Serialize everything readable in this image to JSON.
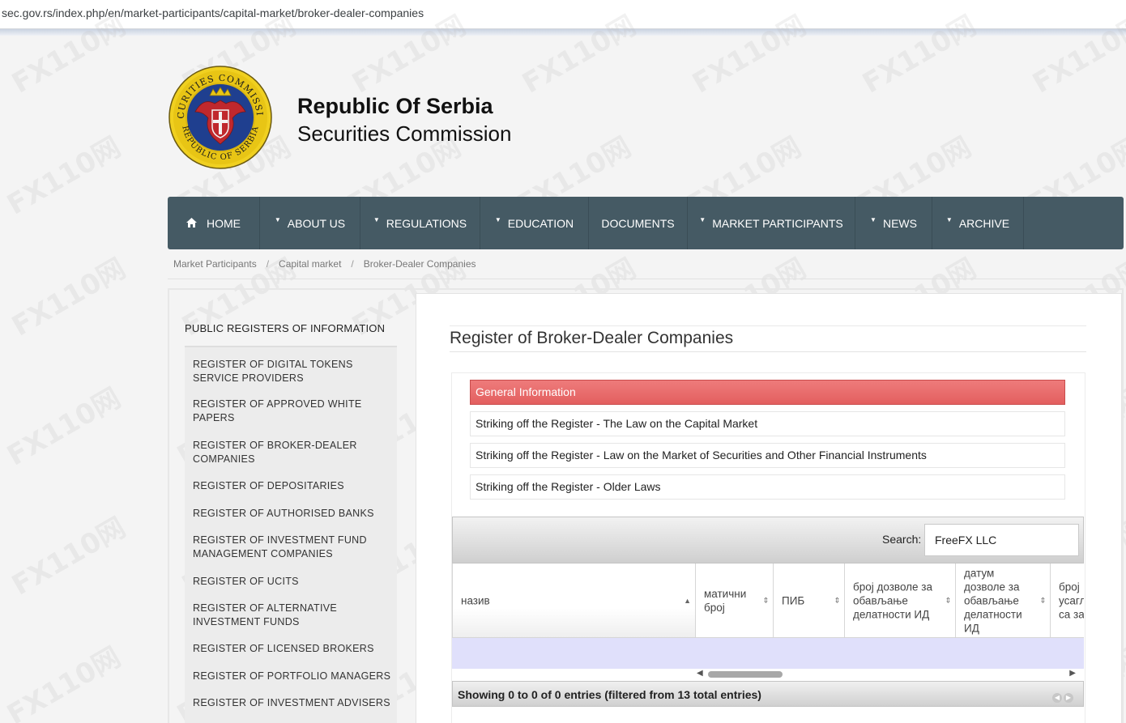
{
  "browser": {
    "url": "sec.gov.rs/index.php/en/market-participants/capital-market/broker-dealer-companies"
  },
  "header": {
    "title": "Republic Of Serbia",
    "subtitle": "Securities Commission",
    "seal_text_top": "SECURITIES COMMISSION",
    "seal_text_bottom": "REPUBLIC OF SERBIA"
  },
  "nav": {
    "items": [
      {
        "label": "HOME",
        "icon": "home-icon",
        "has_dropdown": false
      },
      {
        "label": "ABOUT US",
        "has_dropdown": true
      },
      {
        "label": "REGULATIONS",
        "has_dropdown": true
      },
      {
        "label": "EDUCATION",
        "has_dropdown": true
      },
      {
        "label": "DOCUMENTS",
        "has_dropdown": false
      },
      {
        "label": "MARKET PARTICIPANTS",
        "has_dropdown": true
      },
      {
        "label": "NEWS",
        "has_dropdown": true
      },
      {
        "label": "ARCHIVE",
        "has_dropdown": true
      }
    ],
    "background": "#455a64"
  },
  "breadcrumb": [
    "Market Participants",
    "Capital market",
    "Broker-Dealer Companies"
  ],
  "sidebar": {
    "title": "PUBLIC REGISTERS OF INFORMATION",
    "items": [
      {
        "label": "REGISTER OF DIGITAL TOKENS SERVICE PROVIDERS"
      },
      {
        "label": "REGISTER OF APPROVED WHITE PAPERS"
      },
      {
        "label": "REGISTER OF BROKER-DEALER COMPANIES"
      },
      {
        "label": "REGISTER OF DEPOSITARIES"
      },
      {
        "label": "REGISTER OF AUTHORISED BANKS"
      },
      {
        "label": "REGISTER OF INVESTMENT FUND MANAGEMENT COMPANIES"
      },
      {
        "label": "REGISTER OF UCITS"
      },
      {
        "label": "REGISTER OF ALTERNATIVE INVESTMENT FUNDS"
      },
      {
        "label": "REGISTER OF LICENSED BROKERS"
      },
      {
        "label": "REGISTER OF PORTFOLIO MANAGERS"
      },
      {
        "label": "REGISTER OF INVESTMENT ADVISERS"
      }
    ]
  },
  "main": {
    "title": "Register of Broker-Dealer Companies",
    "accordion": [
      {
        "label": "General Information",
        "active": true
      },
      {
        "label": "Striking off the Register - The Law on the Capital Market",
        "active": false
      },
      {
        "label": "Striking off the Register - Law on the Market of Securities and Other Financial Instruments",
        "active": false
      },
      {
        "label": "Striking off the Register - Older Laws",
        "active": false
      }
    ],
    "accent_active": "#e35f5f",
    "table": {
      "search_label": "Search:",
      "search_value": "FreeFX LLC",
      "columns": [
        {
          "label": "назив",
          "sort": "asc"
        },
        {
          "label": "матични број",
          "sort": "both"
        },
        {
          "label": "ПИБ",
          "sort": "both"
        },
        {
          "label": "број дозволе за обављање делатности ИД",
          "sort": "both"
        },
        {
          "label": "датум дозволе за обављање делатности ИД",
          "sort": "both"
        },
        {
          "label": "број усаглашености са за",
          "sort": "both"
        }
      ],
      "info": "Showing 0 to 0 of 0 entries (filtered from 13 total entries)"
    }
  },
  "watermark": "FX110网"
}
